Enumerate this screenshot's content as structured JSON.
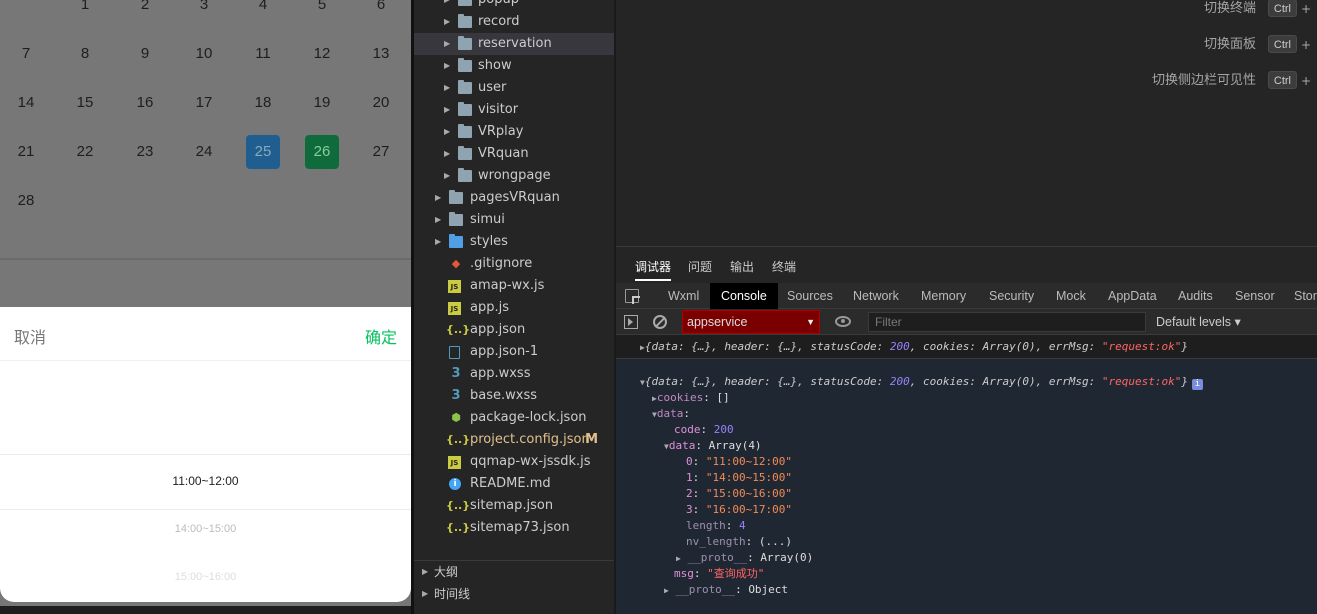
{
  "simulator": {
    "calendar_rows": [
      [
        "1",
        "2",
        "3",
        "4",
        "5",
        "6"
      ],
      [
        "7",
        "8",
        "9",
        "10",
        "11",
        "12",
        "13"
      ],
      [
        "14",
        "15",
        "16",
        "17",
        "18",
        "19",
        "20"
      ],
      [
        "21",
        "22",
        "23",
        "24",
        "25",
        "26",
        "27"
      ],
      [
        "28"
      ]
    ],
    "selected_blue": "25",
    "selected_green": "26",
    "picker": {
      "cancel": "取消",
      "confirm": "确定",
      "options": [
        "11:00~12:00",
        "14:00~15:00",
        "15:00~16:00"
      ]
    }
  },
  "tree": {
    "items": [
      {
        "label": "popup",
        "type": "folder"
      },
      {
        "label": "record",
        "type": "folder"
      },
      {
        "label": "reservation",
        "type": "folder"
      },
      {
        "label": "show",
        "type": "folder"
      },
      {
        "label": "user",
        "type": "folder"
      },
      {
        "label": "visitor",
        "type": "folder"
      },
      {
        "label": "VRplay",
        "type": "folder"
      },
      {
        "label": "VRquan",
        "type": "folder"
      },
      {
        "label": "wrongpage",
        "type": "folder"
      },
      {
        "label": "pagesVRquan",
        "type": "folder"
      },
      {
        "label": "simui",
        "type": "folder"
      },
      {
        "label": "styles",
        "type": "folder"
      },
      {
        "label": ".gitignore",
        "type": "git"
      },
      {
        "label": "amap-wx.js",
        "type": "js"
      },
      {
        "label": "app.js",
        "type": "js"
      },
      {
        "label": "app.json",
        "type": "json"
      },
      {
        "label": "app.json-1",
        "type": "file"
      },
      {
        "label": "app.wxss",
        "type": "css"
      },
      {
        "label": "base.wxss",
        "type": "css"
      },
      {
        "label": "package-lock.json",
        "type": "node"
      },
      {
        "label": "project.config.json",
        "type": "json",
        "flag": "M"
      },
      {
        "label": "qqmap-wx-jssdk.js",
        "type": "js"
      },
      {
        "label": "README.md",
        "type": "info"
      },
      {
        "label": "sitemap.json",
        "type": "json"
      },
      {
        "label": "sitemap73.json",
        "type": "json"
      }
    ],
    "outline": "大纲",
    "timeline": "时间线"
  },
  "shortcuts": [
    {
      "label": "切换终端",
      "key": "Ctrl",
      "plus": "+"
    },
    {
      "label": "切换面板",
      "key": "Ctrl",
      "plus": "+"
    },
    {
      "label": "切换侧边栏可见性",
      "key": "Ctrl",
      "plus": "+"
    }
  ],
  "devtools": {
    "panel_tabs": [
      "调试器",
      "问题",
      "输出",
      "终端"
    ],
    "cdt_tabs": [
      "Wxml",
      "Console",
      "Sources",
      "Network",
      "Memory",
      "Security",
      "Mock",
      "AppData",
      "Audits",
      "Sensor",
      "Stora"
    ],
    "context": "appservice",
    "filter_placeholder": "Filter",
    "levels": "Default levels"
  },
  "console": {
    "summary_parts": {
      "data": "data",
      "header": "header",
      "statusCode": "statusCode",
      "status": "200",
      "cookies": "cookies",
      "array0": "Array(0)",
      "errMsg": "errMsg",
      "msg": "\"request:ok\""
    },
    "cookies_val": "[]",
    "code_val": "200",
    "data_arr": "Array(4)",
    "entries": [
      "\"11:00~12:00\"",
      "\"14:00~15:00\"",
      "\"15:00~16:00\"",
      "\"16:00~17:00\""
    ],
    "length_val": "4",
    "nv_length_val": "(...)",
    "proto_arr": "Array(0)",
    "msg_val": "\"查询成功\"",
    "proto_obj": "Object"
  }
}
